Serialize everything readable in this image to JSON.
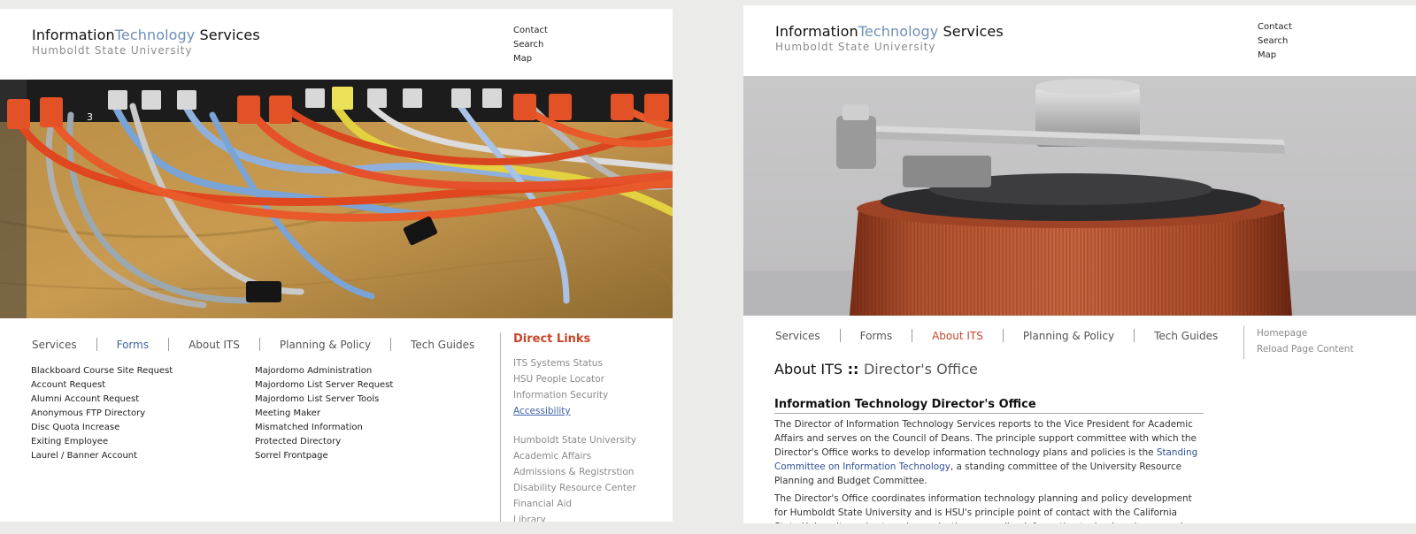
{
  "colors": {
    "accent_blue": "#6d8fb8",
    "link_blue": "#4062a3",
    "accent_orange": "#c9462b"
  },
  "left_page": {
    "brand": {
      "title_part1": "Information",
      "title_part2": "Technology",
      "title_part3": " Services",
      "subtitle": "Humboldt State University"
    },
    "utility_links": [
      "Contact",
      "Search",
      "Map"
    ],
    "nav": {
      "items": [
        "Services",
        "Forms",
        "About ITS",
        "Planning & Policy",
        "Tech Guides"
      ],
      "active": "Forms"
    },
    "forms_col1": [
      "Blackboard Course Site Request",
      "Account Request",
      "Alumni Account Request",
      "Anonymous FTP Directory",
      "Disc Quota Increase",
      "Exiting Employee",
      "Laurel / Banner Account"
    ],
    "forms_col2": [
      "Majordomo Administration",
      "Majordomo List Server Request",
      "Majordomo List Server Tools",
      "Meeting Maker",
      "Mismatched Information",
      "Protected Directory",
      "Sorrel Frontpage"
    ],
    "direct_links": {
      "heading": "Direct Links",
      "group1": [
        "ITS Systems Status",
        "HSU People Locator",
        "Information Security",
        "Accessibility"
      ],
      "group2": [
        "Humboldt State University",
        "Academic Affairs",
        "Admissions & Registrstion",
        "Disability Resource Center",
        "Financial Aid",
        "Library"
      ]
    }
  },
  "right_page": {
    "brand": {
      "title_part1": "Information",
      "title_part2": "Technology",
      "title_part3": " Services",
      "subtitle": "Humboldt State University"
    },
    "utility_links": [
      "Contact",
      "Search",
      "Map"
    ],
    "nav": {
      "items": [
        "Services",
        "Forms",
        "About ITS",
        "Planning & Policy",
        "Tech Guides"
      ],
      "active": "About ITS"
    },
    "side_links": [
      "Homepage",
      "Reload Page Content"
    ],
    "page_title": {
      "part1": "About ITS",
      "separator": " :: ",
      "part2": "Director's Office"
    },
    "section_heading": "Information Technology Director's Office",
    "para1": {
      "before_link": "The Director of Information Technology Services reports to the Vice President for Academic Affairs and serves on the Council of Deans.  The principle support committee with which the Director's Office works to develop information technology plans and policies is the ",
      "link": "Standing Committee on Information Technology",
      "after_link": ", a standing committee of the University Resource Planning and Budget Committee."
    },
    "para2": "The Director's Office coordinates information technology planning and policy development for Humboldt State University and is HSU's principle point of contact with the California State University and external organizations regarding information technology issues and activities."
  }
}
